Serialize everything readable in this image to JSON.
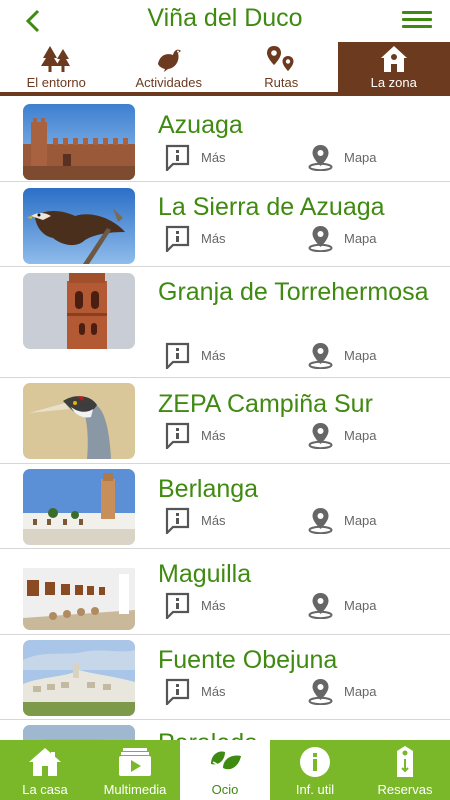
{
  "header": {
    "title": "Viña del Duco"
  },
  "tabs": [
    {
      "label": "El entorno",
      "icon": "trees-icon"
    },
    {
      "label": "Actividades",
      "icon": "bird-icon"
    },
    {
      "label": "Rutas",
      "icon": "route-pins-icon"
    },
    {
      "label": "La zona",
      "icon": "house-icon",
      "active": true
    }
  ],
  "actions": {
    "more": "Más",
    "map": "Mapa"
  },
  "items": [
    {
      "title": "Azuaga"
    },
    {
      "title": "La Sierra de Azuaga"
    },
    {
      "title": "Granja de Torrehermosa"
    },
    {
      "title": "ZEPA Campiña Sur"
    },
    {
      "title": "Berlanga"
    },
    {
      "title": "Maguilla"
    },
    {
      "title": "Fuente Obejuna"
    },
    {
      "title": "Peraleda"
    }
  ],
  "bottom_nav": [
    {
      "label": "La casa",
      "icon": "house-icon"
    },
    {
      "label": "Multimedia",
      "icon": "media-icon"
    },
    {
      "label": "Ocio",
      "icon": "leaves-icon",
      "active": true
    },
    {
      "label": "Inf. util",
      "icon": "info-icon"
    },
    {
      "label": "Reservas",
      "icon": "key-tag-icon"
    }
  ],
  "colors": {
    "green": "#3f8a10",
    "brown": "#6b3a1f",
    "nav_green": "#7ab829"
  }
}
